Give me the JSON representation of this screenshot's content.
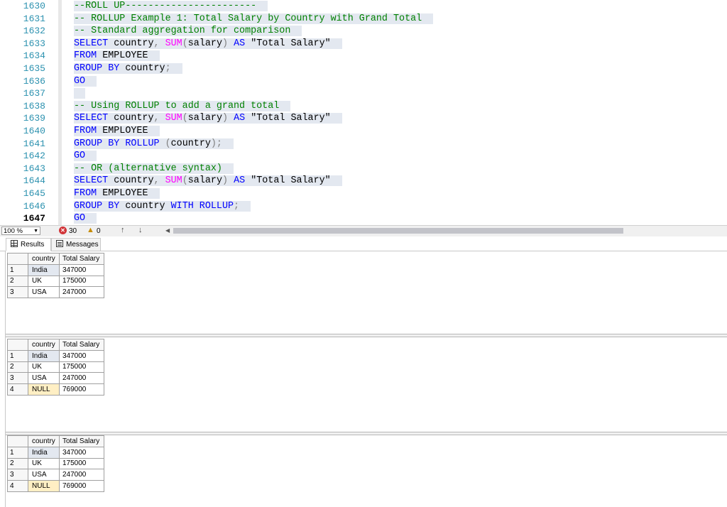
{
  "editor": {
    "lines": [
      {
        "num": "1630",
        "segments": [
          {
            "t": "--ROLL UP-----------------------",
            "c": "cmt"
          }
        ]
      },
      {
        "num": "1631",
        "segments": [
          {
            "t": "-- ROLLUP Example 1: Total Salary by Country with Grand Total",
            "c": "cmt"
          }
        ]
      },
      {
        "num": "1632",
        "segments": [
          {
            "t": "-- Standard aggregation for comparison",
            "c": "cmt"
          }
        ]
      },
      {
        "num": "1633",
        "segments": [
          {
            "t": "SELECT",
            "c": "kw"
          },
          {
            "t": " country",
            "c": ""
          },
          {
            "t": ",",
            "c": "op"
          },
          {
            "t": " ",
            "c": ""
          },
          {
            "t": "SUM",
            "c": "fn"
          },
          {
            "t": "(",
            "c": "op"
          },
          {
            "t": "salary",
            "c": ""
          },
          {
            "t": ")",
            "c": "op"
          },
          {
            "t": " ",
            "c": ""
          },
          {
            "t": "AS",
            "c": "kw"
          },
          {
            "t": " \"Total Salary\"",
            "c": ""
          }
        ]
      },
      {
        "num": "1634",
        "segments": [
          {
            "t": "FROM",
            "c": "kw"
          },
          {
            "t": " EMPLOYEE",
            "c": ""
          }
        ]
      },
      {
        "num": "1635",
        "segments": [
          {
            "t": "GROUP BY",
            "c": "kw"
          },
          {
            "t": " country",
            "c": ""
          },
          {
            "t": ";",
            "c": "op"
          }
        ]
      },
      {
        "num": "1636",
        "segments": [
          {
            "t": "GO",
            "c": "kw"
          }
        ]
      },
      {
        "num": "1637",
        "segments": [
          {
            "t": "",
            "c": ""
          }
        ]
      },
      {
        "num": "1638",
        "segments": [
          {
            "t": "-- Using ROLLUP to add a grand total",
            "c": "cmt"
          }
        ]
      },
      {
        "num": "1639",
        "segments": [
          {
            "t": "SELECT",
            "c": "kw"
          },
          {
            "t": " country",
            "c": ""
          },
          {
            "t": ",",
            "c": "op"
          },
          {
            "t": " ",
            "c": ""
          },
          {
            "t": "SUM",
            "c": "fn"
          },
          {
            "t": "(",
            "c": "op"
          },
          {
            "t": "salary",
            "c": ""
          },
          {
            "t": ")",
            "c": "op"
          },
          {
            "t": " ",
            "c": ""
          },
          {
            "t": "AS",
            "c": "kw"
          },
          {
            "t": " \"Total Salary\"",
            "c": ""
          }
        ]
      },
      {
        "num": "1640",
        "segments": [
          {
            "t": "FROM",
            "c": "kw"
          },
          {
            "t": " EMPLOYEE",
            "c": ""
          }
        ]
      },
      {
        "num": "1641",
        "segments": [
          {
            "t": "GROUP BY ROLLUP",
            "c": "kw"
          },
          {
            "t": " ",
            "c": ""
          },
          {
            "t": "(",
            "c": "op"
          },
          {
            "t": "country",
            "c": ""
          },
          {
            "t": ");",
            "c": "op"
          }
        ]
      },
      {
        "num": "1642",
        "segments": [
          {
            "t": "GO",
            "c": "kw"
          }
        ]
      },
      {
        "num": "1643",
        "segments": [
          {
            "t": "-- OR (alternative syntax)",
            "c": "cmt"
          }
        ]
      },
      {
        "num": "1644",
        "segments": [
          {
            "t": "SELECT",
            "c": "kw"
          },
          {
            "t": " country",
            "c": ""
          },
          {
            "t": ",",
            "c": "op"
          },
          {
            "t": " ",
            "c": ""
          },
          {
            "t": "SUM",
            "c": "fn"
          },
          {
            "t": "(",
            "c": "op"
          },
          {
            "t": "salary",
            "c": ""
          },
          {
            "t": ")",
            "c": "op"
          },
          {
            "t": " ",
            "c": ""
          },
          {
            "t": "AS",
            "c": "kw"
          },
          {
            "t": " \"Total Salary\"",
            "c": ""
          }
        ]
      },
      {
        "num": "1645",
        "segments": [
          {
            "t": "FROM",
            "c": "kw"
          },
          {
            "t": " EMPLOYEE",
            "c": ""
          }
        ]
      },
      {
        "num": "1646",
        "segments": [
          {
            "t": "GROUP BY",
            "c": "kw"
          },
          {
            "t": " country ",
            "c": ""
          },
          {
            "t": "WITH ROLLUP",
            "c": "kw"
          },
          {
            "t": ";",
            "c": "op"
          }
        ]
      },
      {
        "num": "1647",
        "segments": [
          {
            "t": "GO",
            "c": "kw"
          }
        ],
        "current": true
      }
    ]
  },
  "status": {
    "zoom": "100 %",
    "errors": "30",
    "warnings": "0"
  },
  "tabs": {
    "results_label": "Results",
    "messages_label": "Messages"
  },
  "result_sets": [
    {
      "columns": [
        "country",
        "Total Salary"
      ],
      "rows": [
        {
          "n": "1",
          "country": "India",
          "total": "347000"
        },
        {
          "n": "2",
          "country": "UK",
          "total": "175000"
        },
        {
          "n": "3",
          "country": "USA",
          "total": "247000"
        }
      ]
    },
    {
      "columns": [
        "country",
        "Total Salary"
      ],
      "rows": [
        {
          "n": "1",
          "country": "India",
          "total": "347000"
        },
        {
          "n": "2",
          "country": "UK",
          "total": "175000"
        },
        {
          "n": "3",
          "country": "USA",
          "total": "247000"
        },
        {
          "n": "4",
          "country": "NULL",
          "total": "769000"
        }
      ]
    },
    {
      "columns": [
        "country",
        "Total Salary"
      ],
      "rows": [
        {
          "n": "1",
          "country": "India",
          "total": "347000"
        },
        {
          "n": "2",
          "country": "UK",
          "total": "175000"
        },
        {
          "n": "3",
          "country": "USA",
          "total": "247000"
        },
        {
          "n": "4",
          "country": "NULL",
          "total": "769000"
        }
      ]
    }
  ],
  "colors": {
    "keyword": "#0000ff",
    "function": "#ff00ff",
    "comment": "#008000",
    "line_number": "#2b91af",
    "null_cell": "#ffefc4",
    "selection": "#e3e8f0"
  }
}
